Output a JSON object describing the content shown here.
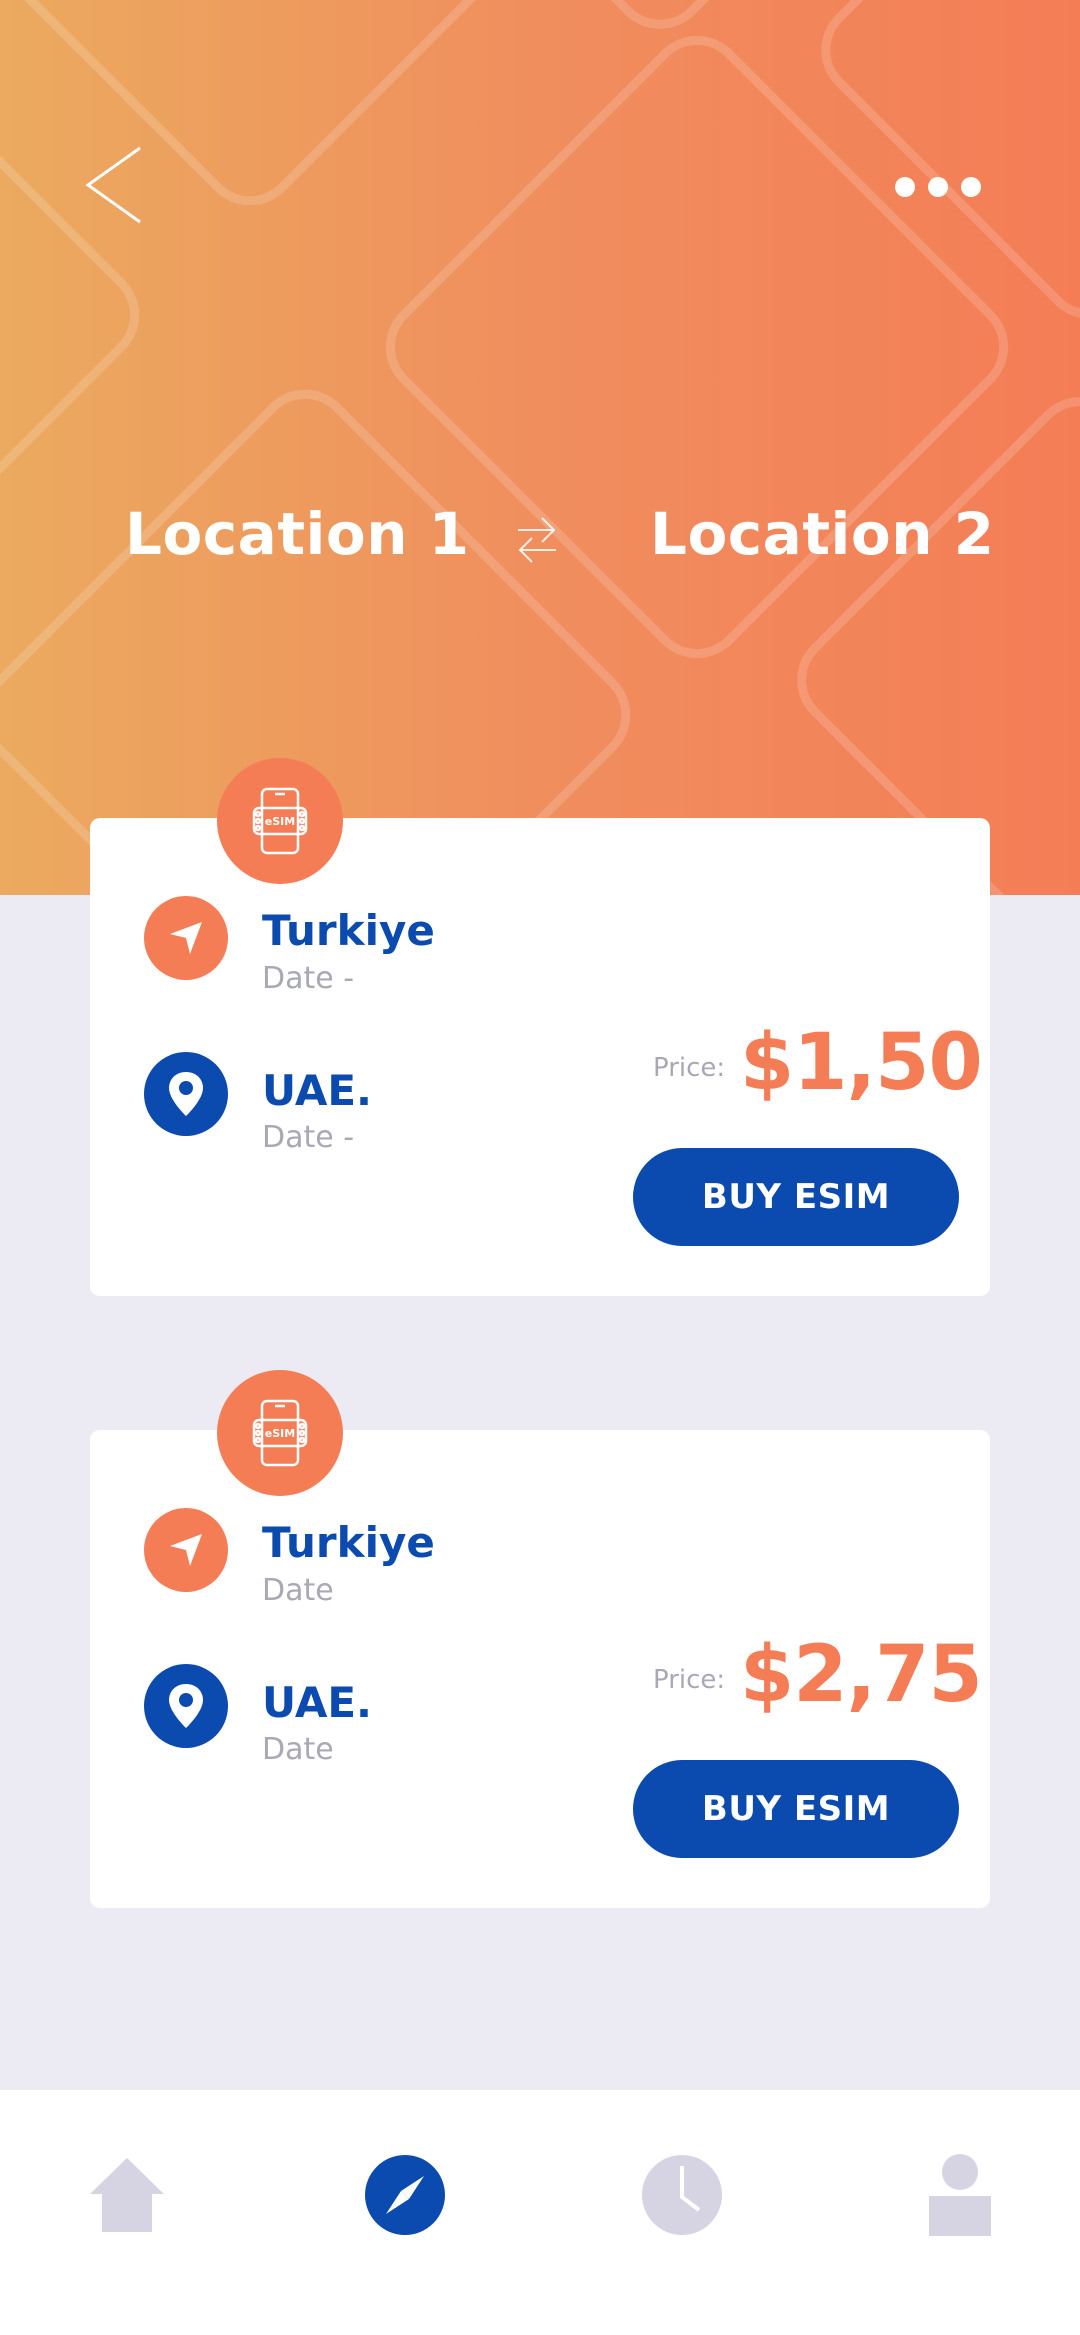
{
  "header": {
    "location_from": "Location 1",
    "location_to": "Location 2",
    "back_icon": "chevron-left-icon",
    "more_icon": "more-dots-icon",
    "swap_icon": "swap-arrows-icon"
  },
  "offers": [
    {
      "badge_icon": "esim-icon",
      "from_place": "Turkiye",
      "from_date": "Date -",
      "to_place": "UAE.",
      "to_date": "Date -",
      "price_label": "Price:",
      "price": "$1,50",
      "button_label": "BUY ESIM"
    },
    {
      "badge_icon": "esim-icon",
      "from_place": "Turkiye",
      "from_date": "Date",
      "to_place": "UAE.",
      "to_date": "Date",
      "price_label": "Price:",
      "price": "$2,75",
      "button_label": "BUY ESIM"
    }
  ],
  "bottom_nav": {
    "items": [
      {
        "icon": "home-icon",
        "active": false
      },
      {
        "icon": "compass-icon",
        "active": true
      },
      {
        "icon": "clock-icon",
        "active": false
      },
      {
        "icon": "profile-icon",
        "active": false
      }
    ]
  },
  "colors": {
    "accent_orange": "#F47D56",
    "gradient_start": "#EBAA5F",
    "brand_blue": "#0B4AAE",
    "background": "#ECEBF3",
    "muted_text": "#A9A9B5",
    "nav_inactive": "#D6D4E2"
  }
}
